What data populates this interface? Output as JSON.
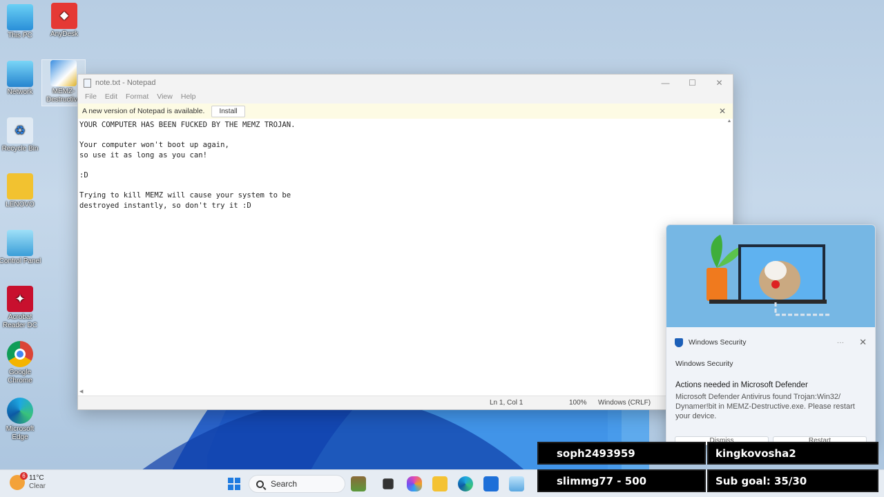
{
  "desktop": {
    "icons": [
      {
        "label": "This PC"
      },
      {
        "label": "AnyDesk"
      },
      {
        "label": "Network"
      },
      {
        "label": "MEMZ-Destructive"
      },
      {
        "label": "Recycle Bin"
      },
      {
        "label": "LENOVO"
      },
      {
        "label": "Control Panel"
      },
      {
        "label": "Acrobat Reader DC"
      },
      {
        "label": "Google Chrome"
      },
      {
        "label": "Microsoft Edge"
      }
    ]
  },
  "notepad": {
    "title": "note.txt - Notepad",
    "menu": [
      "File",
      "Edit",
      "Format",
      "View",
      "Help"
    ],
    "banner_text": "A new version of Notepad is available.",
    "install_label": "Install",
    "content": "YOUR COMPUTER HAS BEEN FUCKED BY THE MEMZ TROJAN.\n\nYour computer won't boot up again,\nso use it as long as you can!\n\n:D\n\nTrying to kill MEMZ will cause your system to be\ndestroyed instantly, so don't try it :D",
    "status": {
      "position": "Ln 1, Col 1",
      "zoom": "100%",
      "line_ending": "Windows (CRLF)"
    }
  },
  "toast": {
    "app_name": "Windows Security",
    "source": "Windows Security",
    "title": "Actions needed in Microsoft Defender",
    "body": "Microsoft Defender Antivirus found Trojan:Win32/ Dynamer!bit in MEMZ-Destructive.exe. Please restart your device.",
    "more": "···",
    "close": "✕",
    "buttons": [
      "Dismiss",
      "Restart"
    ]
  },
  "overlay": {
    "top_left": "soph2493959",
    "top_right": "kingkovosha2",
    "bottom_left": "slimmg77 - 500",
    "bottom_right": "Sub goal: 35/30"
  },
  "taskbar": {
    "temperature": "11°C",
    "condition": "Clear",
    "weather_badge": "6",
    "search_label": "Search"
  }
}
